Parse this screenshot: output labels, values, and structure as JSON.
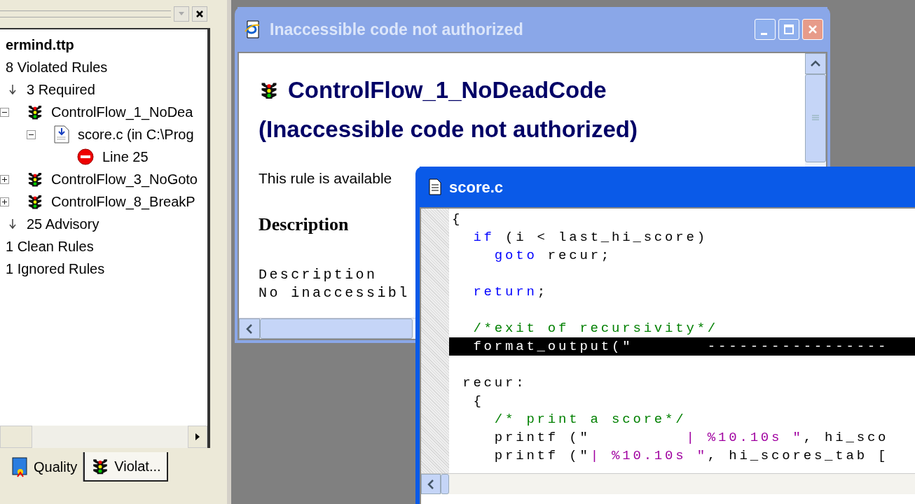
{
  "panel": {
    "tree": [
      {
        "kind": "file",
        "label": "ermind.ttp",
        "children": [
          {
            "kind": "group",
            "label": "8 Violated Rules",
            "children": [
              {
                "kind": "category",
                "label": "3 Required",
                "children": [
                  {
                    "kind": "rule",
                    "label": "ControlFlow_1_NoDea",
                    "expanded": true,
                    "children": [
                      {
                        "kind": "source",
                        "label": "score.c (in C:\\Prog",
                        "expanded": true,
                        "children": [
                          {
                            "kind": "error",
                            "label": "Line 25"
                          }
                        ]
                      }
                    ]
                  },
                  {
                    "kind": "rule",
                    "label": "ControlFlow_3_NoGoto",
                    "expanded": false
                  },
                  {
                    "kind": "rule",
                    "label": "ControlFlow_8_BreakP",
                    "expanded": false
                  }
                ]
              },
              {
                "kind": "category",
                "label": "25 Advisory"
              }
            ]
          },
          {
            "kind": "group",
            "label": "1 Clean Rules"
          },
          {
            "kind": "group",
            "label": "1 Ignored Rules"
          }
        ]
      }
    ],
    "tabs": [
      {
        "kind": "quality",
        "label": "Quality",
        "selected": false
      },
      {
        "kind": "violations",
        "label": "Violat...",
        "selected": true
      }
    ]
  },
  "rule_window": {
    "title": "Inaccessible code not authorized",
    "active": false,
    "heading": "ControlFlow_1_NoDeadCode",
    "subheading": "(Inaccessible code not authorized)",
    "intro": "This rule is available",
    "section": "Description",
    "body": [
      "Description",
      "No inaccessibl"
    ]
  },
  "code_window": {
    "title": "score.c",
    "active": true,
    "lines": [
      {
        "kind": "code",
        "selected": false,
        "segments": [
          {
            "kind": "plain",
            "text": "{"
          }
        ]
      },
      {
        "kind": "code",
        "selected": false,
        "segments": [
          {
            "kind": "keyword",
            "text": "  if"
          },
          {
            "kind": "plain",
            "text": " (i < last_hi_score)"
          }
        ]
      },
      {
        "kind": "code",
        "selected": false,
        "segments": [
          {
            "kind": "keyword",
            "text": "    goto"
          },
          {
            "kind": "plain",
            "text": " recur;"
          }
        ]
      },
      {
        "kind": "blank",
        "selected": false
      },
      {
        "kind": "code",
        "selected": false,
        "segments": [
          {
            "kind": "keyword",
            "text": "  return"
          },
          {
            "kind": "plain",
            "text": ";"
          }
        ]
      },
      {
        "kind": "blank",
        "selected": false
      },
      {
        "kind": "code",
        "selected": false,
        "segments": [
          {
            "kind": "comment",
            "text": "  /*exit of recursivity*/"
          }
        ]
      },
      {
        "kind": "code",
        "selected": true,
        "segments": [
          {
            "kind": "plain",
            "text": "  format_output(\"       -----------------"
          }
        ]
      },
      {
        "kind": "blank",
        "selected": false
      },
      {
        "kind": "code",
        "selected": false,
        "segments": [
          {
            "kind": "plain",
            "text": " recur:"
          }
        ]
      },
      {
        "kind": "code",
        "selected": false,
        "segments": [
          {
            "kind": "plain",
            "text": "  {"
          }
        ]
      },
      {
        "kind": "code",
        "selected": false,
        "segments": [
          {
            "kind": "comment",
            "text": "    /* print a score*/"
          }
        ]
      },
      {
        "kind": "code",
        "selected": false,
        "segments": [
          {
            "kind": "plain",
            "text": "    printf (\""
          },
          {
            "kind": "string",
            "text": "         | %10.10s \""
          },
          {
            "kind": "plain",
            "text": ", hi_sco"
          }
        ]
      },
      {
        "kind": "code",
        "selected": false,
        "segments": [
          {
            "kind": "plain",
            "text": "    printf (\""
          },
          {
            "kind": "string",
            "text": "| %10.10s \""
          },
          {
            "kind": "plain",
            "text": ", hi_scores_tab ["
          }
        ]
      }
    ]
  }
}
